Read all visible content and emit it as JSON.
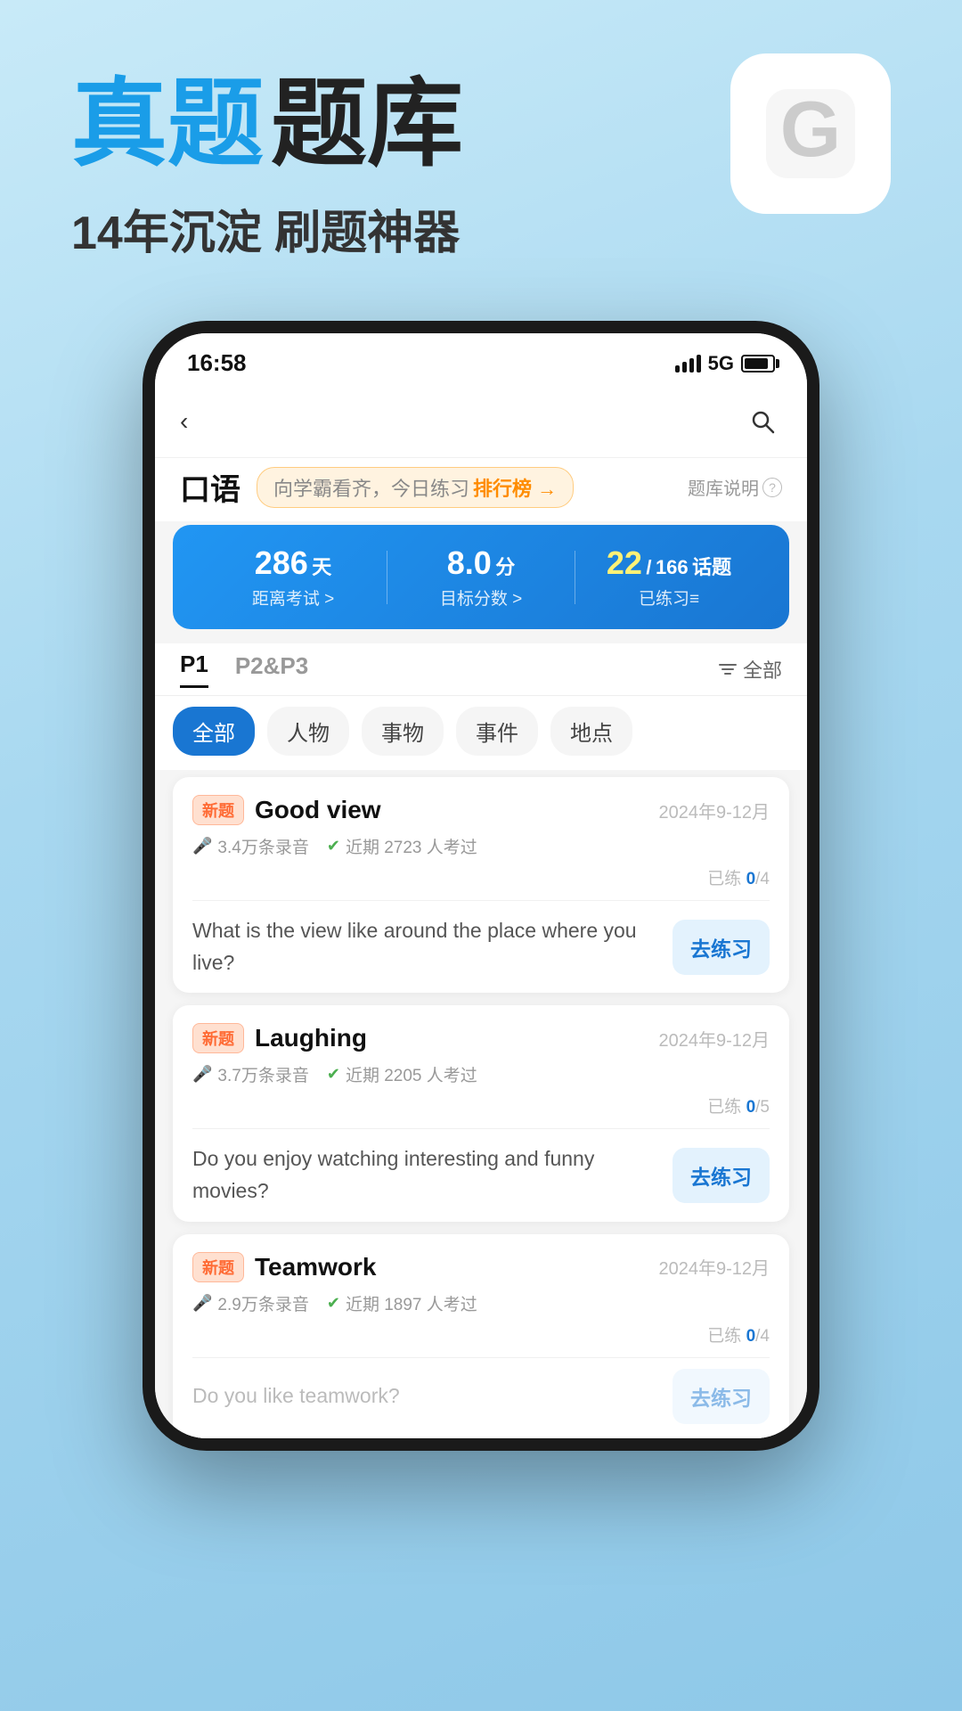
{
  "header": {
    "title_blue": "真题",
    "title_dark": "题库",
    "subtitle": "14年沉淀 刷题神器"
  },
  "status_bar": {
    "time": "16:58",
    "network": "5G"
  },
  "nav": {
    "back_label": "‹",
    "search_label": "🔍"
  },
  "page": {
    "title": "口语",
    "ranking_text": "向学霸看齐，今日练习",
    "ranking_link": "排行榜 →",
    "help_label": "题库说明",
    "help_icon": "?"
  },
  "stats": {
    "days": "286",
    "days_unit": "天",
    "days_label": "距离考试 >",
    "score": "8.0",
    "score_unit": "分",
    "score_label": "目标分数 >",
    "practiced": "22",
    "total": "166",
    "topics_unit": "话题",
    "topics_label": "已练习≡"
  },
  "tabs": [
    {
      "label": "P1",
      "active": true
    },
    {
      "label": "P2&P3",
      "active": false
    }
  ],
  "filter_label": "全部",
  "categories": [
    {
      "label": "全部",
      "active": true
    },
    {
      "label": "人物",
      "active": false
    },
    {
      "label": "事物",
      "active": false
    },
    {
      "label": "事件",
      "active": false
    },
    {
      "label": "地点",
      "active": false
    }
  ],
  "questions": [
    {
      "badge": "新题",
      "title": "Good view",
      "date": "2024年9-12月",
      "recordings": "3.4万条录音",
      "recent_count": "2723",
      "recent_label": "近期 2723 人考过",
      "progress_done": "0",
      "progress_total": "4",
      "question_text": "What is the view like around the place where you live?",
      "practice_btn": "去练习"
    },
    {
      "badge": "新题",
      "title": "Laughing",
      "date": "2024年9-12月",
      "recordings": "3.7万条录音",
      "recent_count": "2205",
      "recent_label": "近期 2205 人考过",
      "progress_done": "0",
      "progress_total": "5",
      "question_text": "Do you enjoy watching interesting and funny movies?",
      "practice_btn": "去练习"
    },
    {
      "badge": "新题",
      "title": "Teamwork",
      "date": "2024年9-12月",
      "recordings": "2.9万条录音",
      "recent_count": "1897",
      "recent_label": "近期 1897 人考过",
      "progress_done": "0",
      "progress_total": "4",
      "question_text": "Do you like teamwork?",
      "practice_btn": "去练习"
    }
  ]
}
